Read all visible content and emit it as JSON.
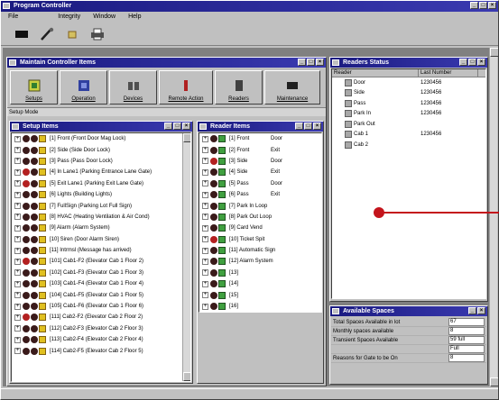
{
  "app": {
    "title": "Program Controller",
    "menu": [
      "File",
      "Integrity",
      "Window",
      "Help"
    ]
  },
  "toolbar": {
    "icons": [
      "card-icon",
      "wrench-icon",
      "key-icon",
      "printer-icon"
    ]
  },
  "maintain": {
    "title": "Maintain Controller Items",
    "buttons": [
      "Setups",
      "Operation",
      "Devices",
      "Remote Action",
      "Readers",
      "Maintenance"
    ],
    "mode": "Setup Mode"
  },
  "left_pane": {
    "title": "Setup Items",
    "items": [
      "[1] Front (Front Door Mag Lock)",
      "[2] Side (Side Door Lock)",
      "[3] Pass (Pass Door Lock)",
      "[4] In Lane1 (Parking Entrance Lane Gate)",
      "[5] Exit Lane1 (Parking Exit Lane Gate)",
      "[6] Lights (Building Lights)",
      "[7] FullSign (Parking Lot Full Sign)",
      "[8] HVAC (Heating Ventilation & Air Cond)",
      "[9] Alarm (Alarm System)",
      "[10] Siren (Door Alarm Siren)",
      "[11] Intrmsl (Message has arrived)",
      "[101] Cab1-F2 (Elevator Cab 1 Floor 2)",
      "[102] Cab1-F3 (Elevator Cab 1 Floor 3)",
      "[103] Cab1-F4 (Elevator Cab 1 Floor 4)",
      "[104] Cab1-F5 (Elevator Cab 1 Floor 5)",
      "[105] Cab1-F6 (Elevator Cab 1 Floor 6)",
      "[111] Cab2-F2 (Elevator Cab 2 Floor 2)",
      "[112] Cab2-F3 (Elevator Cab 2 Floor 3)",
      "[113] Cab2-F4 (Elevator Cab 2 Floor 4)",
      "[114] Cab2-F5 (Elevator Cab 2 Floor 5)"
    ]
  },
  "mid_pane": {
    "title": "Reader Items",
    "items": [
      {
        "label": "[1] Front",
        "dir": "Door"
      },
      {
        "label": "[2] Front",
        "dir": "Exit"
      },
      {
        "label": "[3] Side",
        "dir": "Door"
      },
      {
        "label": "[4] Side",
        "dir": "Exit"
      },
      {
        "label": "[5] Pass",
        "dir": "Door"
      },
      {
        "label": "[6] Pass",
        "dir": "Exit"
      },
      {
        "label": "[7] Park In Loop",
        "dir": ""
      },
      {
        "label": "[8] Park Out Loop",
        "dir": ""
      },
      {
        "label": "[9] Card Vend",
        "dir": ""
      },
      {
        "label": "[10] Ticket Spit",
        "dir": ""
      },
      {
        "label": "[11] Automatic Sign",
        "dir": ""
      },
      {
        "label": "[12] Alarm System",
        "dir": ""
      },
      {
        "label": "[13]",
        "dir": ""
      },
      {
        "label": "[14]",
        "dir": ""
      },
      {
        "label": "[15]",
        "dir": ""
      },
      {
        "label": "[16]",
        "dir": ""
      }
    ]
  },
  "reader_pane": {
    "title": "Readers Status",
    "headers": [
      "Reader",
      "Last Number"
    ],
    "rows": [
      {
        "name": "Door",
        "num": "1230456"
      },
      {
        "name": "Side",
        "num": "1230456"
      },
      {
        "name": "Pass",
        "num": "1230456"
      },
      {
        "name": "Park In",
        "num": "1230456"
      },
      {
        "name": "Park Out",
        "num": ""
      },
      {
        "name": "Cab 1",
        "num": "1230456"
      },
      {
        "name": "Cab 2",
        "num": ""
      }
    ]
  },
  "spaces_pane": {
    "title": "Available Spaces",
    "rows": [
      {
        "label": "Total Spaces Available in lot",
        "value": "67"
      },
      {
        "label": "Monthly spaces available",
        "value": "8"
      },
      {
        "label": "Transient Spaces Available",
        "value": "59 full"
      },
      {
        "label": "",
        "value": "Full"
      },
      {
        "label": "Reasons for Gate to be On",
        "value": "8"
      }
    ]
  },
  "colors": {
    "title_bar": "#1a1a80",
    "callout": "#c4141c"
  }
}
